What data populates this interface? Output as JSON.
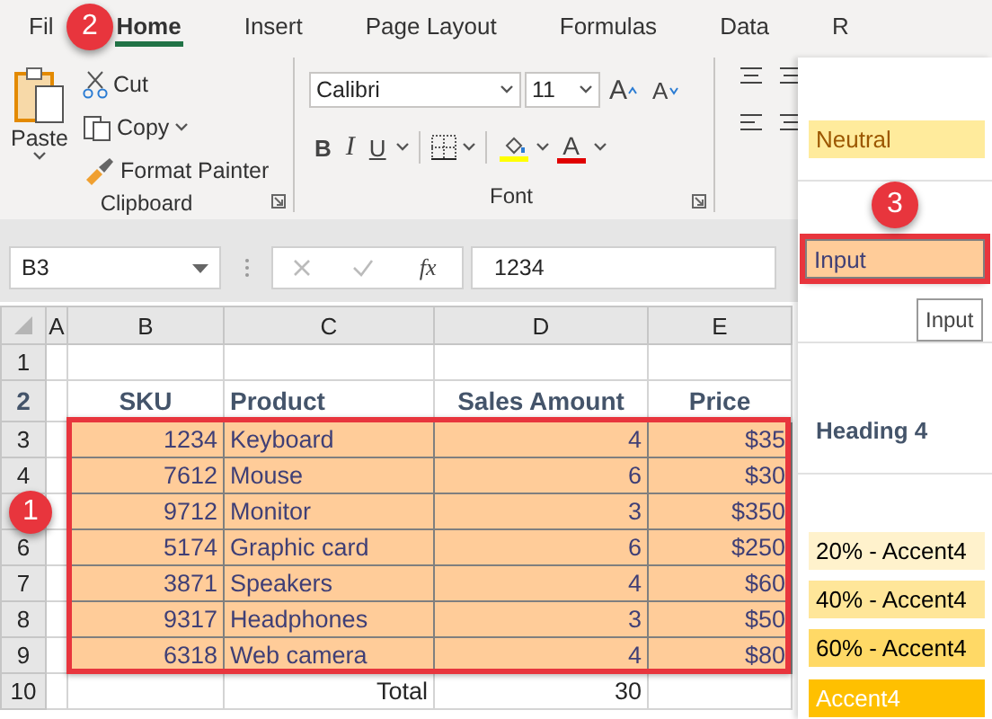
{
  "tabs": [
    {
      "label": "Fil",
      "selected": false
    },
    {
      "label": "Home",
      "selected": true
    },
    {
      "label": "Insert",
      "selected": false
    },
    {
      "label": "Page Layout",
      "selected": false
    },
    {
      "label": "Formulas",
      "selected": false
    },
    {
      "label": "Data",
      "selected": false
    },
    {
      "label": "R",
      "selected": false
    }
  ],
  "clipboard": {
    "paste": "Paste",
    "cut": "Cut",
    "copy": "Copy",
    "format_painter": "Format Painter",
    "group_label": "Clipboard"
  },
  "font": {
    "name": "Calibri",
    "size": "11",
    "grow": "A",
    "shrink": "A",
    "bold": "B",
    "italic": "I",
    "underline": "U",
    "font_color": "A",
    "group_label": "Font"
  },
  "name_box": "B3",
  "fx": "fx",
  "formula": "1234",
  "columns": [
    "A",
    "B",
    "C",
    "D",
    "E"
  ],
  "rows": [
    {
      "number": "1",
      "kind": "empty"
    },
    {
      "number": "2",
      "kind": "header",
      "cells": [
        "SKU",
        "Product",
        "Sales Amount",
        "Price"
      ]
    },
    {
      "number": "3",
      "kind": "data",
      "highlighted": true,
      "cells": [
        "1234",
        "Keyboard",
        "4",
        "$35"
      ]
    },
    {
      "number": "4",
      "kind": "data",
      "highlighted": true,
      "cells": [
        "7612",
        "Mouse",
        "6",
        "$30"
      ]
    },
    {
      "kind": "data",
      "highlighted": true,
      "cells": [
        "9712",
        "Monitor",
        "3",
        "$350"
      ]
    },
    {
      "number": "6",
      "kind": "data",
      "highlighted": true,
      "cells": [
        "5174",
        "Graphic card",
        "6",
        "$250"
      ]
    },
    {
      "number": "7",
      "kind": "data",
      "highlighted": true,
      "cells": [
        "3871",
        "Speakers",
        "4",
        "$60"
      ]
    },
    {
      "number": "8",
      "kind": "data",
      "highlighted": true,
      "cells": [
        "9317",
        "Headphones",
        "3",
        "$50"
      ]
    },
    {
      "number": "9",
      "kind": "data",
      "highlighted": true,
      "cells": [
        "6318",
        "Web camera",
        "4",
        "$80"
      ]
    },
    {
      "number": "10",
      "kind": "total",
      "label": "Total",
      "value": "30"
    }
  ],
  "styles_gallery": [
    {
      "kind": "neutral",
      "label": "Neutral",
      "selected": false
    },
    {
      "kind": "input",
      "label": "Input",
      "selected": true,
      "tooltip": "Input"
    },
    {
      "kind": "heading",
      "label": "Heading 4",
      "selected": false
    },
    {
      "kind": "accent20",
      "label": "20% - Accent4",
      "selected": false
    },
    {
      "kind": "accent40",
      "label": "40% - Accent4",
      "selected": false
    },
    {
      "kind": "accent60",
      "label": "60% - Accent4",
      "selected": false
    },
    {
      "kind": "accent",
      "label": "Accent4",
      "selected": false
    }
  ],
  "badges": [
    "1",
    "2",
    "3"
  ]
}
